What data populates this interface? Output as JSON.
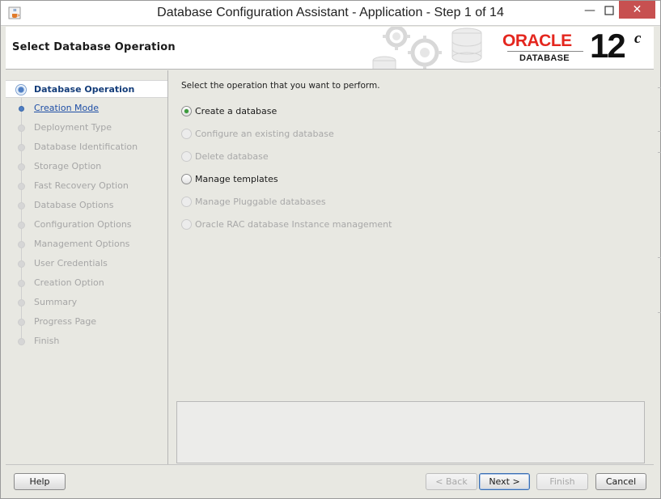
{
  "window": {
    "title": "Database Configuration Assistant - Application - Step 1 of 14",
    "icons": {
      "app": "java-cup-icon",
      "minimize": "minimize-icon",
      "maximize": "maximize-icon",
      "close": "close-icon"
    },
    "glyphs": {
      "minimize": "—",
      "maximize": "□",
      "close": "✕"
    },
    "close_color": "#c75050"
  },
  "header": {
    "page_title": "Select Database Operation",
    "logo": {
      "brand": "ORACLE",
      "registered": "®",
      "product": "DATABASE",
      "version": "12",
      "version_suffix": "c"
    },
    "brand_color": "#e4261e"
  },
  "nav": {
    "items": [
      {
        "label": "Database Operation",
        "state": "current"
      },
      {
        "label": "Creation Mode",
        "state": "next"
      },
      {
        "label": "Deployment Type",
        "state": "disabled"
      },
      {
        "label": "Database Identification",
        "state": "disabled"
      },
      {
        "label": "Storage Option",
        "state": "disabled"
      },
      {
        "label": "Fast Recovery Option",
        "state": "disabled"
      },
      {
        "label": "Database Options",
        "state": "disabled"
      },
      {
        "label": "Configuration Options",
        "state": "disabled"
      },
      {
        "label": "Management Options",
        "state": "disabled"
      },
      {
        "label": "User Credentials",
        "state": "disabled"
      },
      {
        "label": "Creation Option",
        "state": "disabled"
      },
      {
        "label": "Summary",
        "state": "disabled"
      },
      {
        "label": "Progress Page",
        "state": "disabled"
      },
      {
        "label": "Finish",
        "state": "disabled"
      }
    ]
  },
  "main": {
    "instruction": "Select the operation that you want to perform.",
    "options": [
      {
        "label": "Create a database",
        "checked": true,
        "enabled": true
      },
      {
        "label": "Configure an existing database",
        "checked": false,
        "enabled": false
      },
      {
        "label": "Delete database",
        "checked": false,
        "enabled": false
      },
      {
        "label": "Manage templates",
        "checked": false,
        "enabled": true
      },
      {
        "label": "Manage Pluggable databases",
        "checked": false,
        "enabled": false
      },
      {
        "label": "Oracle RAC database Instance management",
        "checked": false,
        "enabled": false
      }
    ],
    "selected_color": "#3b9b3b"
  },
  "buttons": {
    "help": {
      "label": "Help",
      "enabled": true
    },
    "back": {
      "label": "< Back",
      "enabled": false
    },
    "next": {
      "label": "Next >",
      "enabled": true,
      "default": true
    },
    "finish": {
      "label": "Finish",
      "enabled": false
    },
    "cancel": {
      "label": "Cancel",
      "enabled": true
    }
  },
  "accent_color": "#1f4fa6"
}
